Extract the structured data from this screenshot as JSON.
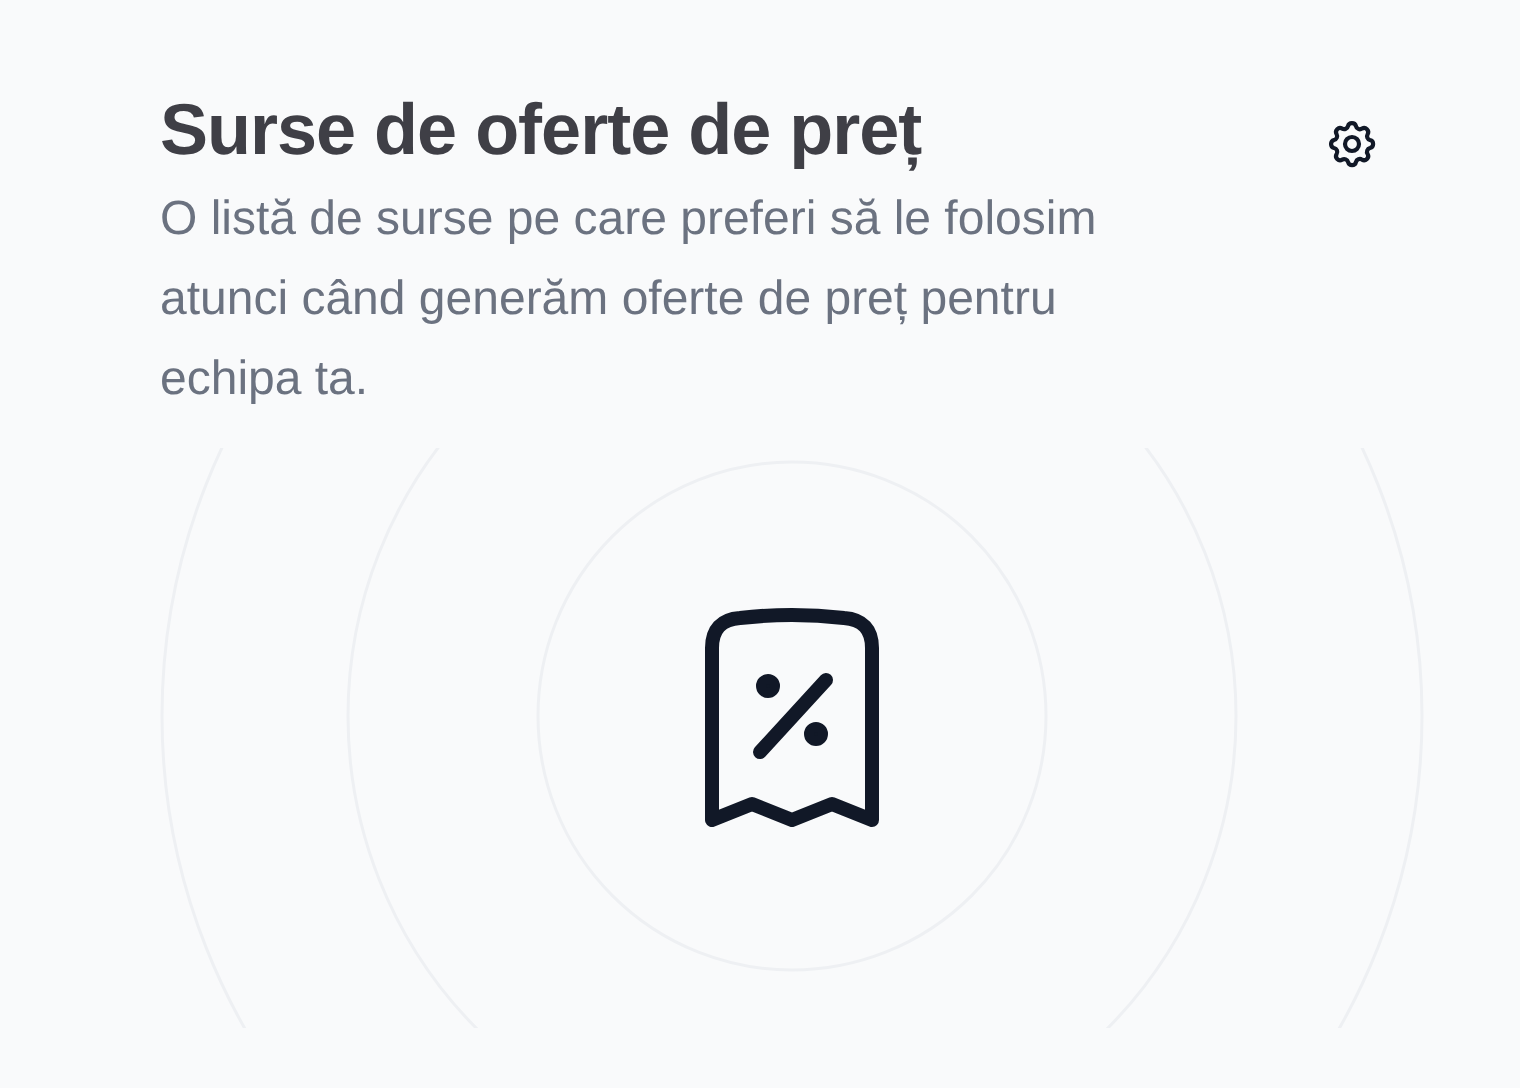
{
  "header": {
    "title": "Surse de oferte de preț",
    "description": "O listă de surse pe care preferi să le folosim atunci când generăm oferte de preț pentru echipa ta."
  }
}
